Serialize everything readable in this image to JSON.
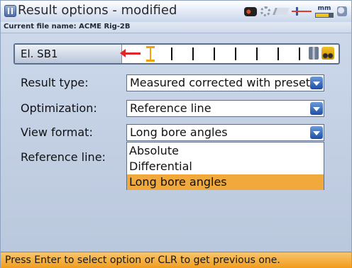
{
  "window": {
    "title": "Result options - modified",
    "subtitle": "Current file name: ACME Rig-2B",
    "icons": [
      "app-icon",
      "camera-icon",
      "gear-icon",
      "ruler-icon",
      "alignment-icon",
      "battery-mm-icon",
      "hand-icon"
    ],
    "units_label": "mm"
  },
  "selector": {
    "label": "El. SB1",
    "tick_count": 8,
    "active_tick_index": 0
  },
  "form": {
    "result_type": {
      "label": "Result type:",
      "value": "Measured corrected with preset"
    },
    "optimization": {
      "label": "Optimization:",
      "value": "Reference line"
    },
    "view_format": {
      "label": "View format:",
      "value": "Long bore angles",
      "options": [
        "Absolute",
        "Differential",
        "Long bore angles"
      ],
      "selected_index": 2
    },
    "reference_line": {
      "label": "Reference line:"
    }
  },
  "status": {
    "text": "Press Enter to select option or CLR to get previous one."
  },
  "colors": {
    "selection": "#f2a93b",
    "status_bar": "#f19b1c",
    "dropdown_button": "#1d4ea8",
    "pointer": "#e0262a",
    "active_tick": "#f0a40a"
  }
}
